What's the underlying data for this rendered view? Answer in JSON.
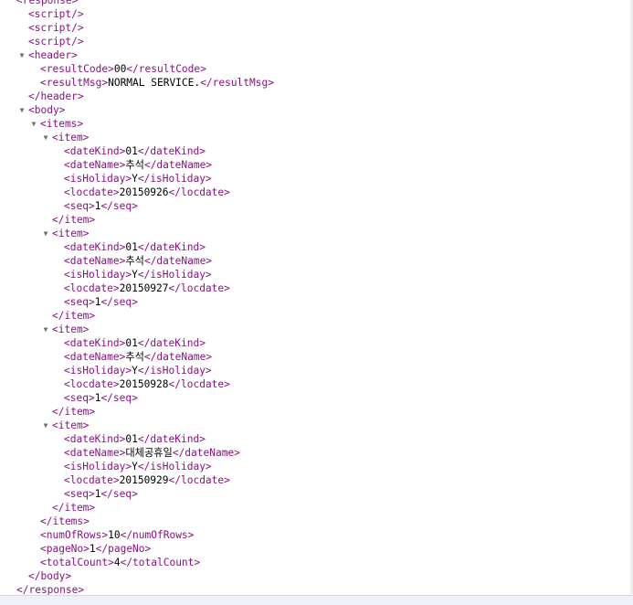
{
  "xml_viewer": {
    "lines": [
      {
        "indent": 0,
        "toggle": "",
        "text": "<response>",
        "kind": "tag"
      },
      {
        "indent": 1,
        "toggle": "",
        "text": "<script/>",
        "kind": "tag"
      },
      {
        "indent": 1,
        "toggle": "",
        "text": "<script/>",
        "kind": "tag"
      },
      {
        "indent": 1,
        "toggle": "",
        "text": "<script/>",
        "kind": "tag"
      },
      {
        "indent": 1,
        "toggle": "▼",
        "text": "<header>",
        "kind": "tag"
      },
      {
        "indent": 2,
        "toggle": "",
        "open": "<resultCode>",
        "value": "00",
        "close": "</resultCode>",
        "kind": "leaf"
      },
      {
        "indent": 2,
        "toggle": "",
        "open": "<resultMsg>",
        "value": "NORMAL SERVICE.",
        "close": "</resultMsg>",
        "kind": "leaf"
      },
      {
        "indent": 1,
        "toggle": "",
        "text": "</header>",
        "kind": "tag"
      },
      {
        "indent": 1,
        "toggle": "▼",
        "text": "<body>",
        "kind": "tag"
      },
      {
        "indent": 2,
        "toggle": "▼",
        "text": "<items>",
        "kind": "tag"
      },
      {
        "indent": 3,
        "toggle": "▼",
        "text": "<item>",
        "kind": "tag"
      },
      {
        "indent": 4,
        "toggle": "",
        "open": "<dateKind>",
        "value": "01",
        "close": "</dateKind>",
        "kind": "leaf"
      },
      {
        "indent": 4,
        "toggle": "",
        "open": "<dateName>",
        "value": "추석",
        "close": "</dateName>",
        "kind": "leaf"
      },
      {
        "indent": 4,
        "toggle": "",
        "open": "<isHoliday>",
        "value": "Y",
        "close": "</isHoliday>",
        "kind": "leaf"
      },
      {
        "indent": 4,
        "toggle": "",
        "open": "<locdate>",
        "value": "20150926",
        "close": "</locdate>",
        "kind": "leaf"
      },
      {
        "indent": 4,
        "toggle": "",
        "open": "<seq>",
        "value": "1",
        "close": "</seq>",
        "kind": "leaf"
      },
      {
        "indent": 3,
        "toggle": "",
        "text": "</item>",
        "kind": "tag"
      },
      {
        "indent": 3,
        "toggle": "▼",
        "text": "<item>",
        "kind": "tag"
      },
      {
        "indent": 4,
        "toggle": "",
        "open": "<dateKind>",
        "value": "01",
        "close": "</dateKind>",
        "kind": "leaf"
      },
      {
        "indent": 4,
        "toggle": "",
        "open": "<dateName>",
        "value": "추석",
        "close": "</dateName>",
        "kind": "leaf"
      },
      {
        "indent": 4,
        "toggle": "",
        "open": "<isHoliday>",
        "value": "Y",
        "close": "</isHoliday>",
        "kind": "leaf"
      },
      {
        "indent": 4,
        "toggle": "",
        "open": "<locdate>",
        "value": "20150927",
        "close": "</locdate>",
        "kind": "leaf"
      },
      {
        "indent": 4,
        "toggle": "",
        "open": "<seq>",
        "value": "1",
        "close": "</seq>",
        "kind": "leaf"
      },
      {
        "indent": 3,
        "toggle": "",
        "text": "</item>",
        "kind": "tag"
      },
      {
        "indent": 3,
        "toggle": "▼",
        "text": "<item>",
        "kind": "tag"
      },
      {
        "indent": 4,
        "toggle": "",
        "open": "<dateKind>",
        "value": "01",
        "close": "</dateKind>",
        "kind": "leaf"
      },
      {
        "indent": 4,
        "toggle": "",
        "open": "<dateName>",
        "value": "추석",
        "close": "</dateName>",
        "kind": "leaf"
      },
      {
        "indent": 4,
        "toggle": "",
        "open": "<isHoliday>",
        "value": "Y",
        "close": "</isHoliday>",
        "kind": "leaf"
      },
      {
        "indent": 4,
        "toggle": "",
        "open": "<locdate>",
        "value": "20150928",
        "close": "</locdate>",
        "kind": "leaf"
      },
      {
        "indent": 4,
        "toggle": "",
        "open": "<seq>",
        "value": "1",
        "close": "</seq>",
        "kind": "leaf"
      },
      {
        "indent": 3,
        "toggle": "",
        "text": "</item>",
        "kind": "tag"
      },
      {
        "indent": 3,
        "toggle": "▼",
        "text": "<item>",
        "kind": "tag"
      },
      {
        "indent": 4,
        "toggle": "",
        "open": "<dateKind>",
        "value": "01",
        "close": "</dateKind>",
        "kind": "leaf"
      },
      {
        "indent": 4,
        "toggle": "",
        "open": "<dateName>",
        "value": "대체공휴일",
        "close": "</dateName>",
        "kind": "leaf"
      },
      {
        "indent": 4,
        "toggle": "",
        "open": "<isHoliday>",
        "value": "Y",
        "close": "</isHoliday>",
        "kind": "leaf"
      },
      {
        "indent": 4,
        "toggle": "",
        "open": "<locdate>",
        "value": "20150929",
        "close": "</locdate>",
        "kind": "leaf"
      },
      {
        "indent": 4,
        "toggle": "",
        "open": "<seq>",
        "value": "1",
        "close": "</seq>",
        "kind": "leaf"
      },
      {
        "indent": 3,
        "toggle": "",
        "text": "</item>",
        "kind": "tag"
      },
      {
        "indent": 2,
        "toggle": "",
        "text": "</items>",
        "kind": "tag"
      },
      {
        "indent": 2,
        "toggle": "",
        "open": "<numOfRows>",
        "value": "10",
        "close": "</numOfRows>",
        "kind": "leaf"
      },
      {
        "indent": 2,
        "toggle": "",
        "open": "<pageNo>",
        "value": "1",
        "close": "</pageNo>",
        "kind": "leaf"
      },
      {
        "indent": 2,
        "toggle": "",
        "open": "<totalCount>",
        "value": "4",
        "close": "</totalCount>",
        "kind": "leaf"
      },
      {
        "indent": 1,
        "toggle": "",
        "text": "</body>",
        "kind": "tag"
      },
      {
        "indent": 0,
        "toggle": "",
        "text": "</response>",
        "kind": "tag"
      }
    ]
  },
  "colors": {
    "tag": "#881280",
    "value": "#000000",
    "toggle": "#6e6e6e"
  }
}
